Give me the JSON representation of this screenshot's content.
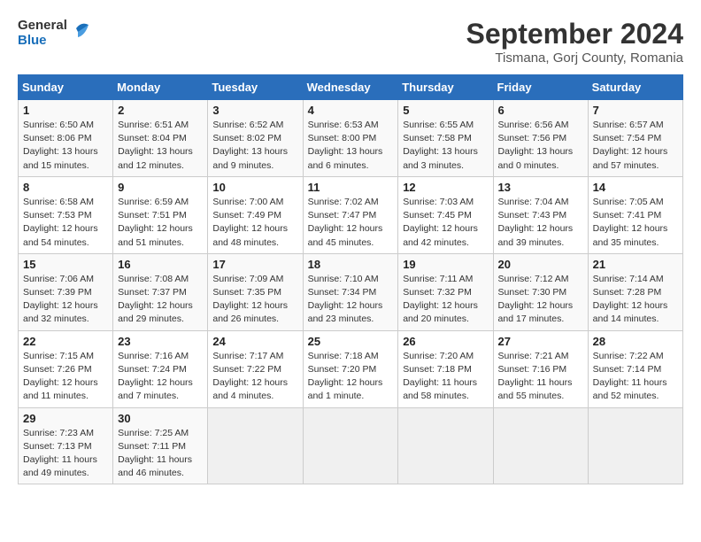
{
  "header": {
    "logo_line1": "General",
    "logo_line2": "Blue",
    "month_title": "September 2024",
    "subtitle": "Tismana, Gorj County, Romania"
  },
  "weekdays": [
    "Sunday",
    "Monday",
    "Tuesday",
    "Wednesday",
    "Thursday",
    "Friday",
    "Saturday"
  ],
  "weeks": [
    [
      {
        "day": "1",
        "info": "Sunrise: 6:50 AM\nSunset: 8:06 PM\nDaylight: 13 hours\nand 15 minutes."
      },
      {
        "day": "2",
        "info": "Sunrise: 6:51 AM\nSunset: 8:04 PM\nDaylight: 13 hours\nand 12 minutes."
      },
      {
        "day": "3",
        "info": "Sunrise: 6:52 AM\nSunset: 8:02 PM\nDaylight: 13 hours\nand 9 minutes."
      },
      {
        "day": "4",
        "info": "Sunrise: 6:53 AM\nSunset: 8:00 PM\nDaylight: 13 hours\nand 6 minutes."
      },
      {
        "day": "5",
        "info": "Sunrise: 6:55 AM\nSunset: 7:58 PM\nDaylight: 13 hours\nand 3 minutes."
      },
      {
        "day": "6",
        "info": "Sunrise: 6:56 AM\nSunset: 7:56 PM\nDaylight: 13 hours\nand 0 minutes."
      },
      {
        "day": "7",
        "info": "Sunrise: 6:57 AM\nSunset: 7:54 PM\nDaylight: 12 hours\nand 57 minutes."
      }
    ],
    [
      {
        "day": "8",
        "info": "Sunrise: 6:58 AM\nSunset: 7:53 PM\nDaylight: 12 hours\nand 54 minutes."
      },
      {
        "day": "9",
        "info": "Sunrise: 6:59 AM\nSunset: 7:51 PM\nDaylight: 12 hours\nand 51 minutes."
      },
      {
        "day": "10",
        "info": "Sunrise: 7:00 AM\nSunset: 7:49 PM\nDaylight: 12 hours\nand 48 minutes."
      },
      {
        "day": "11",
        "info": "Sunrise: 7:02 AM\nSunset: 7:47 PM\nDaylight: 12 hours\nand 45 minutes."
      },
      {
        "day": "12",
        "info": "Sunrise: 7:03 AM\nSunset: 7:45 PM\nDaylight: 12 hours\nand 42 minutes."
      },
      {
        "day": "13",
        "info": "Sunrise: 7:04 AM\nSunset: 7:43 PM\nDaylight: 12 hours\nand 39 minutes."
      },
      {
        "day": "14",
        "info": "Sunrise: 7:05 AM\nSunset: 7:41 PM\nDaylight: 12 hours\nand 35 minutes."
      }
    ],
    [
      {
        "day": "15",
        "info": "Sunrise: 7:06 AM\nSunset: 7:39 PM\nDaylight: 12 hours\nand 32 minutes."
      },
      {
        "day": "16",
        "info": "Sunrise: 7:08 AM\nSunset: 7:37 PM\nDaylight: 12 hours\nand 29 minutes."
      },
      {
        "day": "17",
        "info": "Sunrise: 7:09 AM\nSunset: 7:35 PM\nDaylight: 12 hours\nand 26 minutes."
      },
      {
        "day": "18",
        "info": "Sunrise: 7:10 AM\nSunset: 7:34 PM\nDaylight: 12 hours\nand 23 minutes."
      },
      {
        "day": "19",
        "info": "Sunrise: 7:11 AM\nSunset: 7:32 PM\nDaylight: 12 hours\nand 20 minutes."
      },
      {
        "day": "20",
        "info": "Sunrise: 7:12 AM\nSunset: 7:30 PM\nDaylight: 12 hours\nand 17 minutes."
      },
      {
        "day": "21",
        "info": "Sunrise: 7:14 AM\nSunset: 7:28 PM\nDaylight: 12 hours\nand 14 minutes."
      }
    ],
    [
      {
        "day": "22",
        "info": "Sunrise: 7:15 AM\nSunset: 7:26 PM\nDaylight: 12 hours\nand 11 minutes."
      },
      {
        "day": "23",
        "info": "Sunrise: 7:16 AM\nSunset: 7:24 PM\nDaylight: 12 hours\nand 7 minutes."
      },
      {
        "day": "24",
        "info": "Sunrise: 7:17 AM\nSunset: 7:22 PM\nDaylight: 12 hours\nand 4 minutes."
      },
      {
        "day": "25",
        "info": "Sunrise: 7:18 AM\nSunset: 7:20 PM\nDaylight: 12 hours\nand 1 minute."
      },
      {
        "day": "26",
        "info": "Sunrise: 7:20 AM\nSunset: 7:18 PM\nDaylight: 11 hours\nand 58 minutes."
      },
      {
        "day": "27",
        "info": "Sunrise: 7:21 AM\nSunset: 7:16 PM\nDaylight: 11 hours\nand 55 minutes."
      },
      {
        "day": "28",
        "info": "Sunrise: 7:22 AM\nSunset: 7:14 PM\nDaylight: 11 hours\nand 52 minutes."
      }
    ],
    [
      {
        "day": "29",
        "info": "Sunrise: 7:23 AM\nSunset: 7:13 PM\nDaylight: 11 hours\nand 49 minutes."
      },
      {
        "day": "30",
        "info": "Sunrise: 7:25 AM\nSunset: 7:11 PM\nDaylight: 11 hours\nand 46 minutes."
      },
      {
        "day": "",
        "info": ""
      },
      {
        "day": "",
        "info": ""
      },
      {
        "day": "",
        "info": ""
      },
      {
        "day": "",
        "info": ""
      },
      {
        "day": "",
        "info": ""
      }
    ]
  ]
}
